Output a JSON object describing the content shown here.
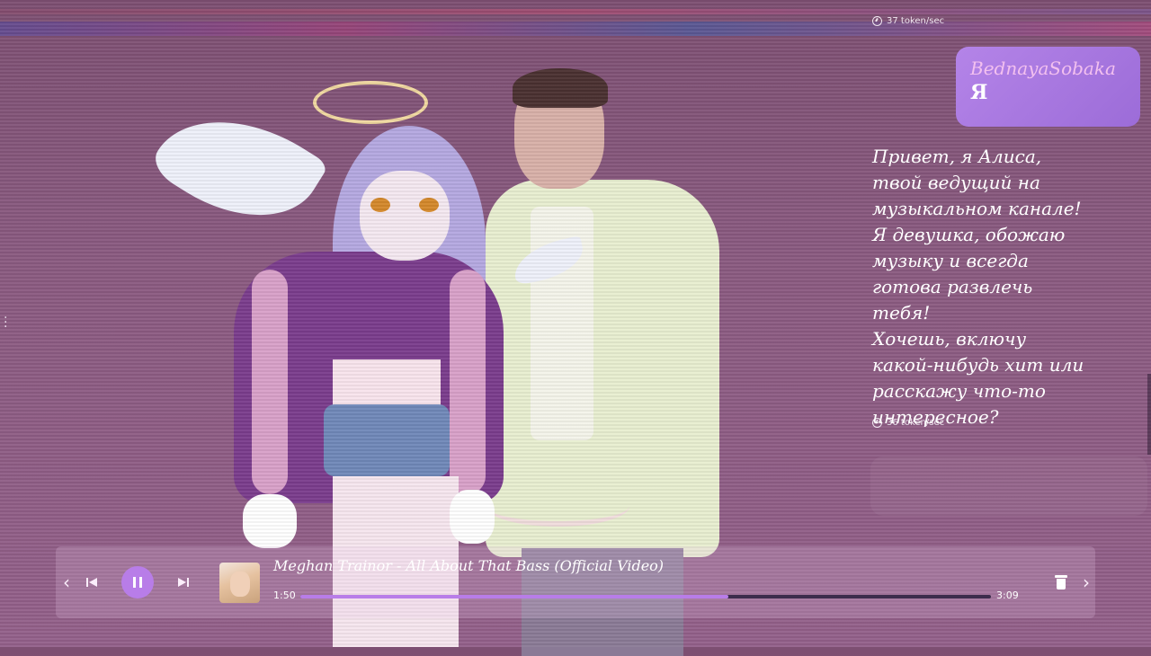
{
  "chat": {
    "top_speed": "37 token/sec",
    "user_message": {
      "name": "BednayaSobaka",
      "text": "Я"
    },
    "assistant_message": {
      "text": "  Привет, я Алиса, твой ведущий на музыкальном канале!\n Я девушка, обожаю музыку и всегда готова развлечь тебя!\nХочешь, включу какой-нибудь хит или расскажу что-то интересное?",
      "speed": "36 token/sec"
    }
  },
  "player": {
    "track_title": "Meghan Trainor - All About That Bass (Official Video)",
    "current_time": "1:50",
    "duration": "3:09",
    "progress": 0.62,
    "state": "playing"
  },
  "colors": {
    "accent": "#b87de8",
    "user_bubble": "#a878e0",
    "username": "#f3c0ef"
  },
  "icons": {
    "prev": "chevron-left-icon",
    "skip_prev": "skip-previous-icon",
    "pause": "pause-icon",
    "skip_next": "skip-next-icon",
    "delete": "trash-icon",
    "next": "chevron-right-icon",
    "speed": "speedometer-icon",
    "menu": "vertical-dots-icon"
  }
}
